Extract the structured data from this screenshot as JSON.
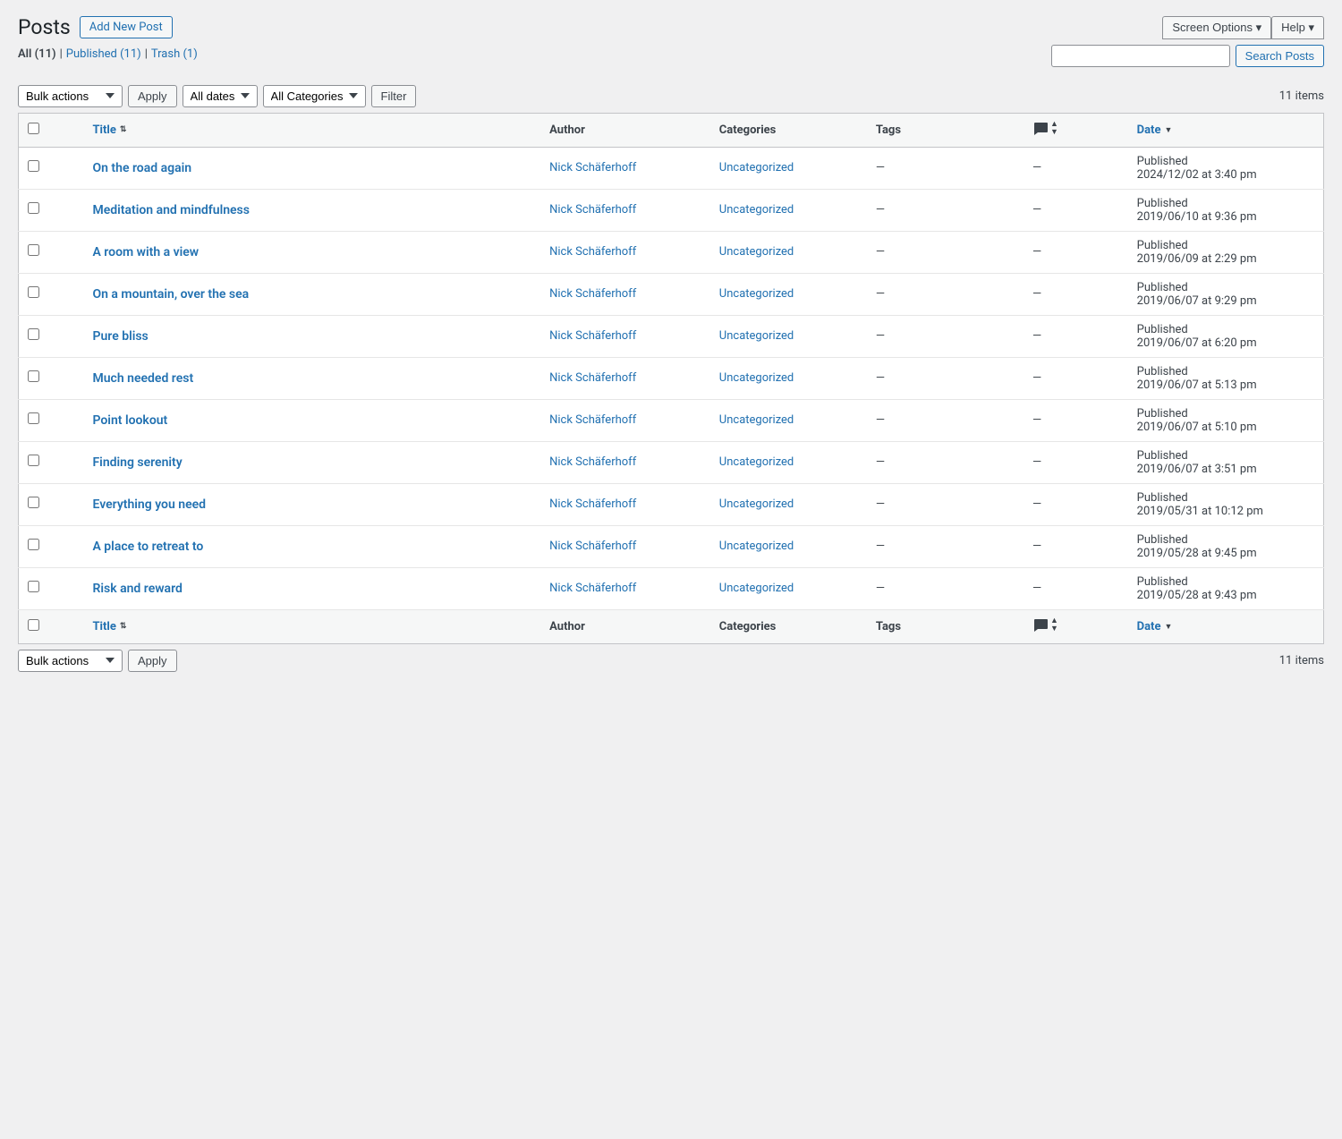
{
  "header": {
    "title": "Posts",
    "add_new_label": "Add New Post",
    "screen_options_label": "Screen Options ▾",
    "help_label": "Help ▾"
  },
  "filter_bar": {
    "all_label": "All (11)",
    "published_label": "Published (11)",
    "trash_label": "Trash (1)",
    "bulk_actions_default": "Bulk actions",
    "apply_label": "Apply",
    "all_dates_label": "All dates",
    "all_categories_label": "All Categories",
    "filter_label": "Filter",
    "items_count": "11 items",
    "search_placeholder": "",
    "search_btn_label": "Search Posts"
  },
  "table": {
    "columns": {
      "title": "Title",
      "author": "Author",
      "categories": "Categories",
      "tags": "Tags",
      "date": "Date"
    },
    "posts": [
      {
        "title": "On the road again",
        "author": "Nick Schäferhoff",
        "categories": "Uncategorized",
        "tags": "—",
        "comments": "—",
        "date_status": "Published",
        "date_value": "2024/12/02 at 3:40 pm"
      },
      {
        "title": "Meditation and mindfulness",
        "author": "Nick Schäferhoff",
        "categories": "Uncategorized",
        "tags": "—",
        "comments": "—",
        "date_status": "Published",
        "date_value": "2019/06/10 at 9:36 pm"
      },
      {
        "title": "A room with a view",
        "author": "Nick Schäferhoff",
        "categories": "Uncategorized",
        "tags": "—",
        "comments": "—",
        "date_status": "Published",
        "date_value": "2019/06/09 at 2:29 pm"
      },
      {
        "title": "On a mountain, over the sea",
        "author": "Nick Schäferhoff",
        "categories": "Uncategorized",
        "tags": "—",
        "comments": "—",
        "date_status": "Published",
        "date_value": "2019/06/07 at 9:29 pm"
      },
      {
        "title": "Pure bliss",
        "author": "Nick Schäferhoff",
        "categories": "Uncategorized",
        "tags": "—",
        "comments": "—",
        "date_status": "Published",
        "date_value": "2019/06/07 at 6:20 pm"
      },
      {
        "title": "Much needed rest",
        "author": "Nick Schäferhoff",
        "categories": "Uncategorized",
        "tags": "—",
        "comments": "—",
        "date_status": "Published",
        "date_value": "2019/06/07 at 5:13 pm"
      },
      {
        "title": "Point lookout",
        "author": "Nick Schäferhoff",
        "categories": "Uncategorized",
        "tags": "—",
        "comments": "—",
        "date_status": "Published",
        "date_value": "2019/06/07 at 5:10 pm"
      },
      {
        "title": "Finding serenity",
        "author": "Nick Schäferhoff",
        "categories": "Uncategorized",
        "tags": "—",
        "comments": "—",
        "date_status": "Published",
        "date_value": "2019/06/07 at 3:51 pm"
      },
      {
        "title": "Everything you need",
        "author": "Nick Schäferhoff",
        "categories": "Uncategorized",
        "tags": "—",
        "comments": "—",
        "date_status": "Published",
        "date_value": "2019/05/31 at 10:12 pm"
      },
      {
        "title": "A place to retreat to",
        "author": "Nick Schäferhoff",
        "categories": "Uncategorized",
        "tags": "—",
        "comments": "—",
        "date_status": "Published",
        "date_value": "2019/05/28 at 9:45 pm"
      },
      {
        "title": "Risk and reward",
        "author": "Nick Schäferhoff",
        "categories": "Uncategorized",
        "tags": "—",
        "comments": "—",
        "date_status": "Published",
        "date_value": "2019/05/28 at 9:43 pm"
      }
    ]
  },
  "bottom": {
    "bulk_actions_label": "Bulk actions",
    "apply_label": "Apply",
    "items_count": "11 items"
  }
}
